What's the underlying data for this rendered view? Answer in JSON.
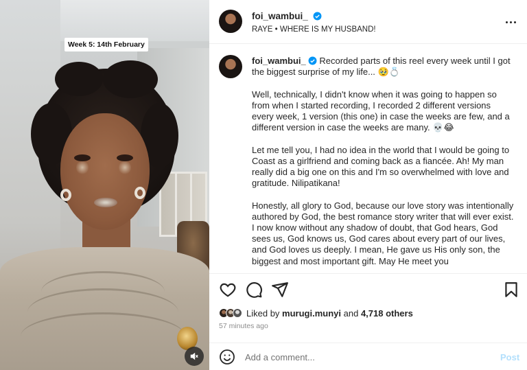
{
  "media": {
    "week_label": "Week 5: 14th February",
    "mute_icon": "speaker-muted-icon"
  },
  "header": {
    "username": "foi_wambui_",
    "audio": "RAYE • WHERE IS MY HUSBAND!",
    "verified_icon": "verified-badge-icon",
    "more_icon": "more-dots-icon"
  },
  "caption": {
    "username": "foi_wambui_",
    "first_line": "Recorded parts of this reel every week until I got the biggest surprise of my life... 🥹💍",
    "paragraphs": [
      "Well, technically, I didn't know when it was going to happen so from when I started recording, I recorded 2 different versions every week, 1 version (this one) in case the weeks are few, and a different version in case the weeks are many. 💀😂",
      "Let me tell you, I had no idea in the world that I would be going to Coast as a girlfriend and coming back as a fiancée. Ah! My man really did a big one on this and I'm so overwhelmed with love and gratitude. Nilipatikana!",
      "Honestly, all glory to God, because our love story was intentionally authored by God, the best romance story writer that will ever exist. I now know without any shadow of doubt, that God hears, God sees us, God knows us, God cares about every part of our lives, and God loves us deeply. I mean, He gave us His only son, the biggest and most important gift. May He meet you"
    ]
  },
  "actions": {
    "like_icon": "heart-icon",
    "comment_icon": "comment-bubble-icon",
    "share_icon": "paper-plane-icon",
    "save_icon": "bookmark-icon"
  },
  "likes": {
    "prefix": "Liked by",
    "user": "murugi.munyi",
    "conjunction": "and",
    "others": "4,718 others"
  },
  "timestamp": "57 minutes ago",
  "comment": {
    "emoji_icon": "smiley-icon",
    "placeholder": "Add a comment...",
    "post_label": "Post"
  },
  "colors": {
    "verified": "#0095f6",
    "post_disabled": "#b2dffc",
    "text": "#262626",
    "muted": "#8e8e8e"
  }
}
